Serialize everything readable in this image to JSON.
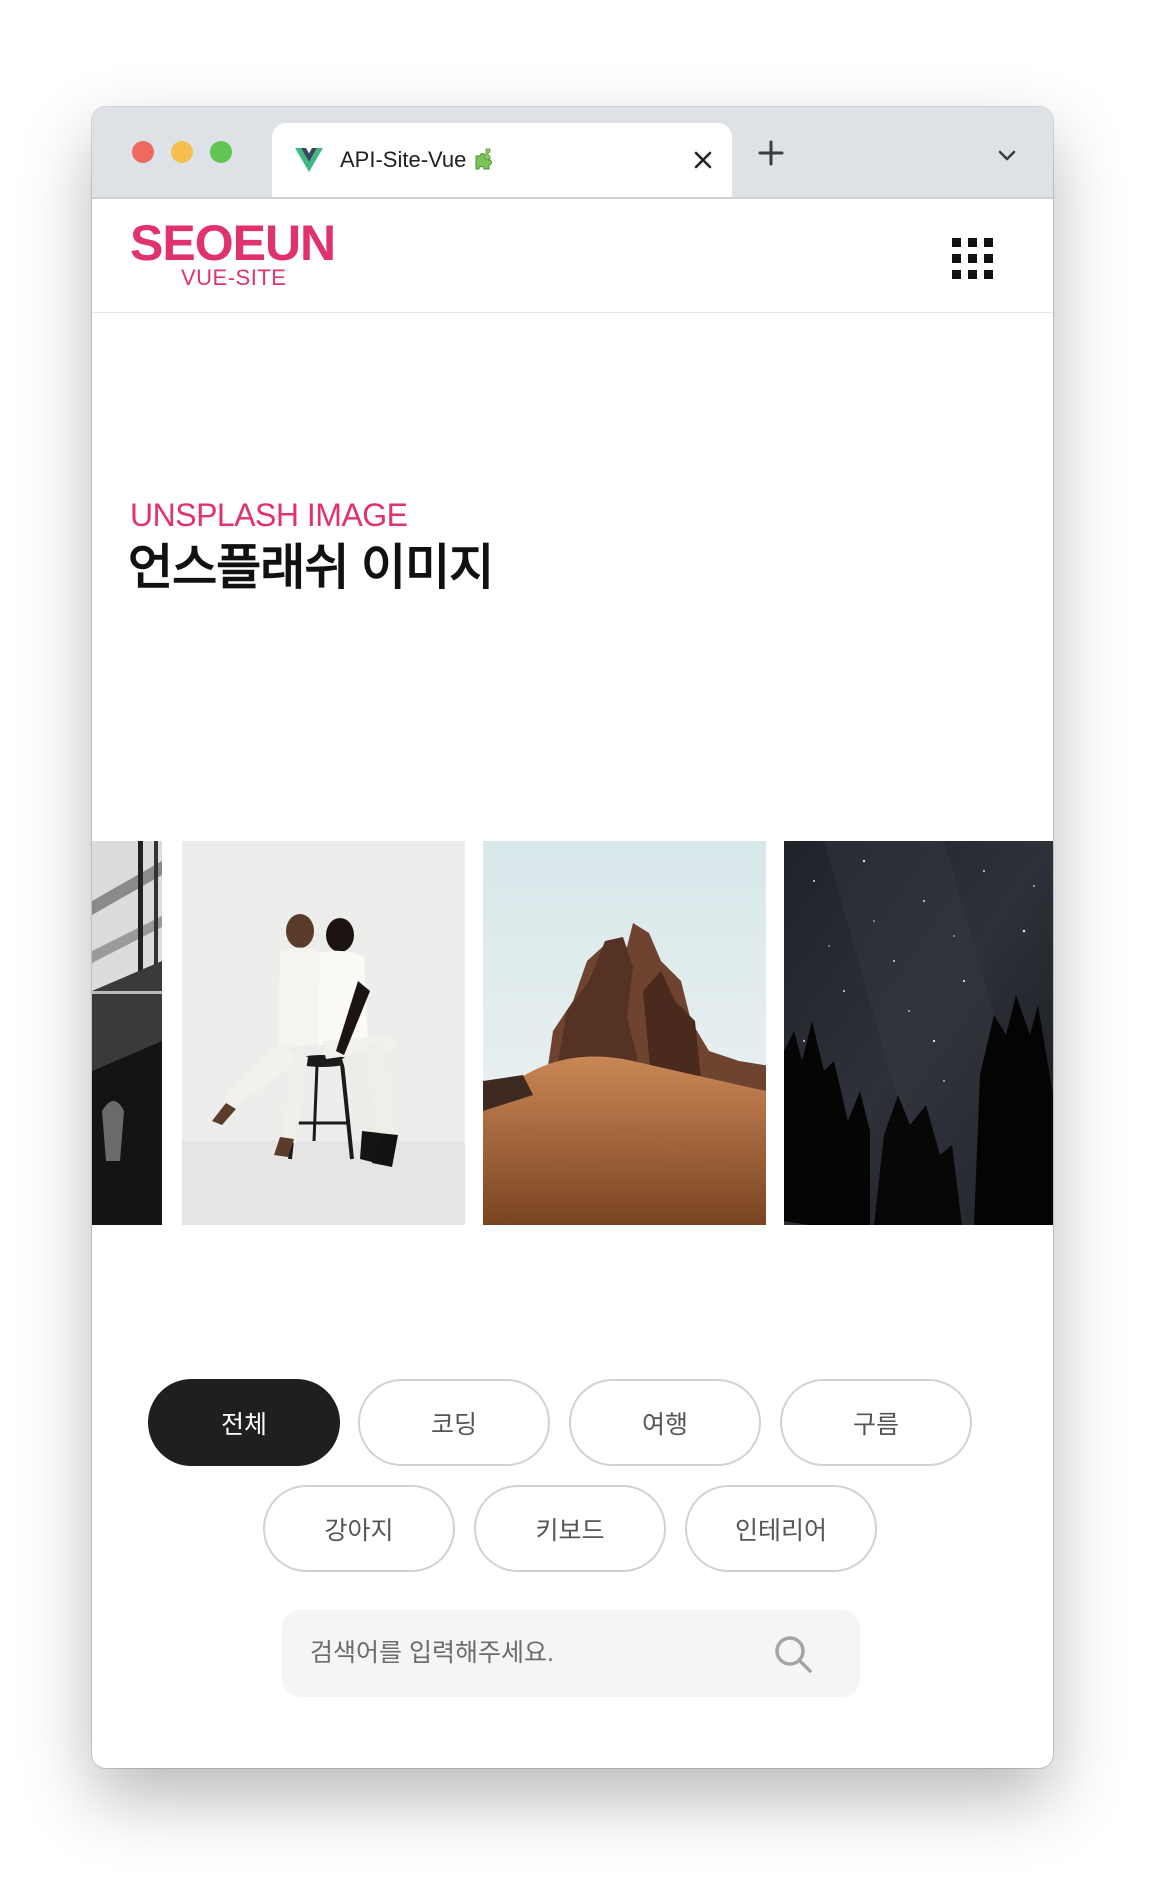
{
  "browser": {
    "tab_title": "API-Site-Vue",
    "tab_emoji_icon": "puzzle-piece-icon",
    "favicon_icon": "vue-logo-icon",
    "close_icon": "close-icon",
    "new_tab_icon": "plus-icon",
    "tab_menu_icon": "chevron-down-icon"
  },
  "header": {
    "logo_main": "SEOEUN",
    "logo_sub": "VUE-SITE",
    "menu_icon": "grid-menu-icon"
  },
  "section": {
    "title_en": "UNSPLASH IMAGE",
    "title_ko": "언스플래쉬 이미지"
  },
  "slider": {
    "items": [
      {
        "subject": "black-and-white architecture"
      },
      {
        "subject": "two people posing on a stool"
      },
      {
        "subject": "desert rock formations"
      },
      {
        "subject": "starry night sky with trees"
      }
    ]
  },
  "filters": {
    "items": [
      {
        "label": "전체",
        "active": true
      },
      {
        "label": "코딩",
        "active": false
      },
      {
        "label": "여행",
        "active": false
      },
      {
        "label": "구름",
        "active": false
      },
      {
        "label": "강아지",
        "active": false
      },
      {
        "label": "키보드",
        "active": false
      },
      {
        "label": "인테리어",
        "active": false
      }
    ]
  },
  "search": {
    "placeholder": "검색어를 입력해주세요.",
    "value": "",
    "icon": "search-icon"
  },
  "colors": {
    "accent": "#e0336e",
    "active_pill": "#1f1f1f",
    "text_dark": "#111111"
  }
}
